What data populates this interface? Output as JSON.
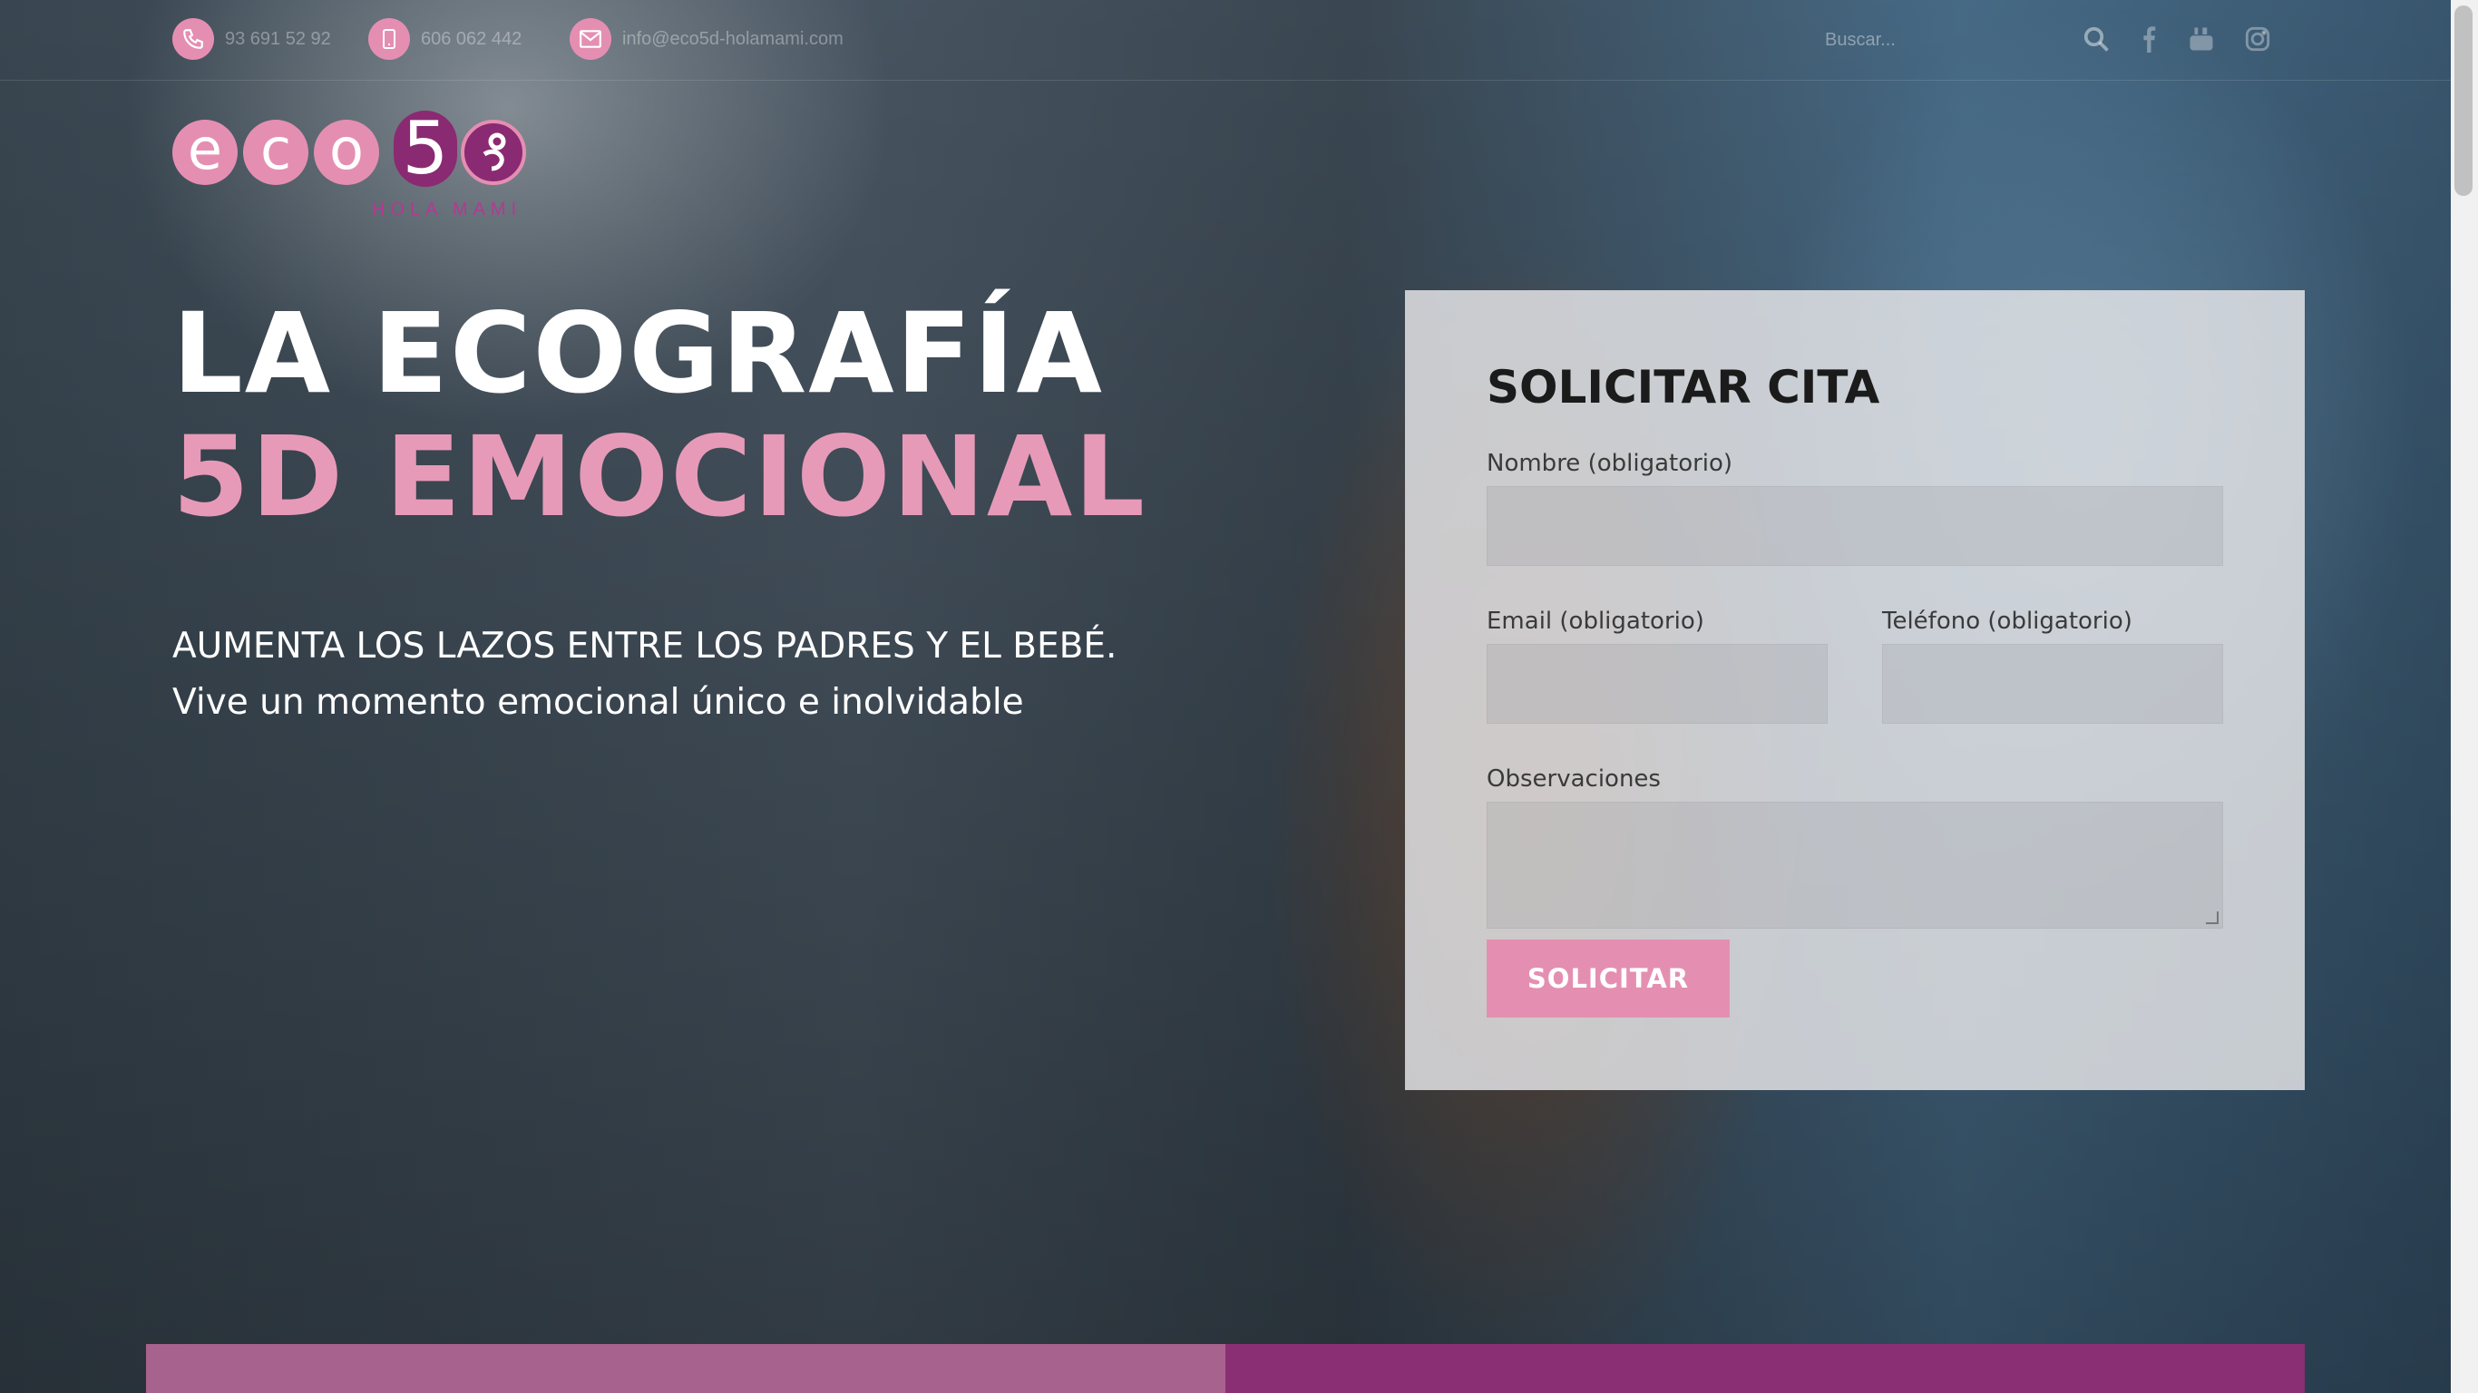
{
  "topbar": {
    "phone": "93 691 52 92",
    "mobile": "606 062 442",
    "email": "info@eco5d-holamami.com",
    "search_placeholder": "Buscar..."
  },
  "logo": {
    "letters": [
      "e",
      "c",
      "o"
    ],
    "number": "5",
    "tagline": "HOLA MAMI"
  },
  "hero": {
    "title_line1": "LA ECOGRAFÍA",
    "title_line2": "5D EMOCIONAL",
    "subtitle_line1": "AUMENTA LOS LAZOS ENTRE LOS PADRES Y EL BEBÉ.",
    "subtitle_line2": "Vive un momento emocional único e inolvidable"
  },
  "form": {
    "title": "SOLICITAR CITA",
    "name_label": "Nombre (obligatorio)",
    "email_label": "Email (obligatorio)",
    "phone_label": "Teléfono (obligatorio)",
    "notes_label": "Observaciones",
    "submit_label": "SOLICITAR"
  },
  "colors": {
    "accent_pink": "#e48fb2",
    "accent_purple": "#8a2f73",
    "bar_left": "#a8628e",
    "bar_right": "#8a2f73"
  },
  "icons": [
    "phone-icon",
    "mobile-icon",
    "mail-icon",
    "search-icon",
    "facebook-icon",
    "youtube-icon",
    "instagram-icon"
  ]
}
